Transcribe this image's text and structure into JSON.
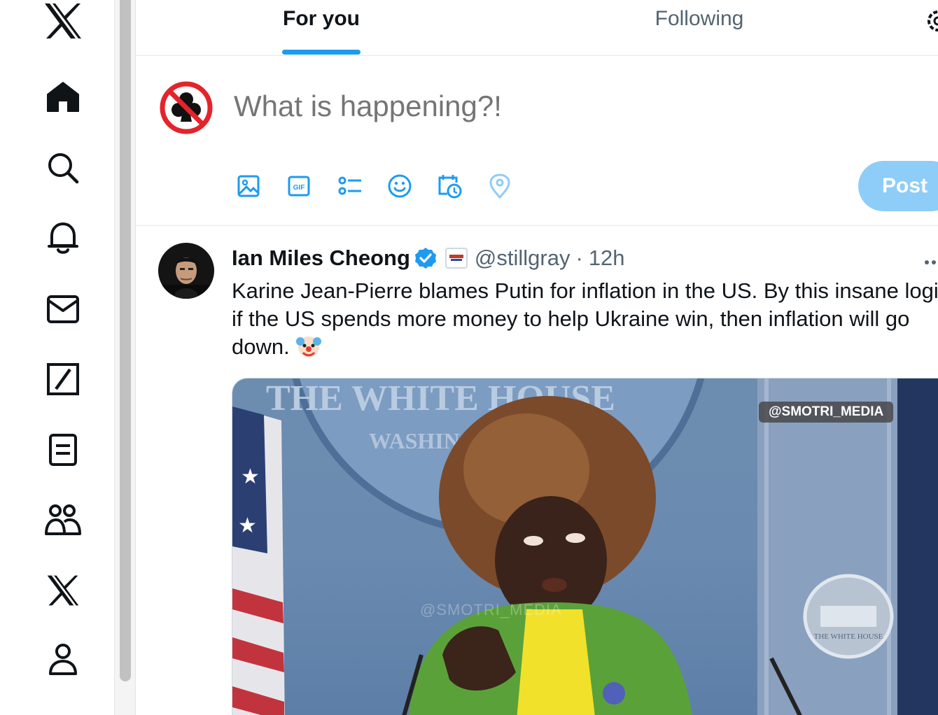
{
  "nav": {
    "items": [
      {
        "name": "logo",
        "icon": "x-logo-icon"
      },
      {
        "name": "home",
        "icon": "home-icon"
      },
      {
        "name": "explore",
        "icon": "search-icon"
      },
      {
        "name": "notifications",
        "icon": "bell-icon"
      },
      {
        "name": "messages",
        "icon": "envelope-icon"
      },
      {
        "name": "grok",
        "icon": "grok-icon"
      },
      {
        "name": "lists",
        "icon": "list-icon"
      },
      {
        "name": "communities",
        "icon": "people-icon"
      },
      {
        "name": "premium",
        "icon": "x-logo-icon"
      },
      {
        "name": "profile",
        "icon": "person-icon"
      }
    ]
  },
  "tabs": {
    "for_you": "For you",
    "following": "Following",
    "active": "For you"
  },
  "composer": {
    "placeholder": "What is happening?!",
    "post_label": "Post",
    "tools": [
      "image-icon",
      "gif-icon",
      "poll-icon",
      "emoji-icon",
      "schedule-icon",
      "location-icon"
    ],
    "gif_text": "GIF"
  },
  "tweet": {
    "author_name": "Ian Miles Cheong",
    "handle": "@stillgray",
    "separator": "·",
    "time": "12h",
    "text": "Karine Jean-Pierre blames Putin for inflation in the US. By this insane logic, if the US spends more money to help Ukraine win, then inflation will go down.",
    "emoji": "clown-face-emoji",
    "media": {
      "watermark": "@SMOTRI_MEDIA",
      "faded_caption": "@SMOTRI_MEDIA",
      "seal_top_text": "THE WHITE HOUSE",
      "seal_sub_text": "WASHINGTON",
      "small_seal_text": "THE WHITE HOUSE"
    }
  },
  "colors": {
    "accent": "#1d9bf0",
    "post_button_disabled": "#8ecdf8",
    "text_primary": "#0f1419",
    "text_secondary": "#536471"
  }
}
